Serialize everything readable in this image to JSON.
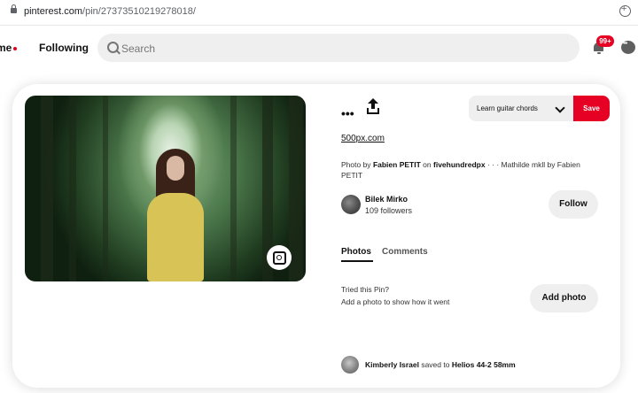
{
  "browser": {
    "url_host": "pinterest.com",
    "url_path": "/pin/273735102192780​18/"
  },
  "nav": {
    "home_label": "me",
    "following_label": "Following",
    "search_placeholder": "Search",
    "notification_count": "99+"
  },
  "pin": {
    "board_name": "Learn guitar chords",
    "save_label": "Save",
    "source_link": "500px.com",
    "credit": {
      "prefix": "Photo by",
      "author": "Fabien PETIT",
      "on": "on",
      "site": "fivehundredpx",
      "suffix": "· · · Mathilde mkll by Fabien PETIT"
    },
    "creator": {
      "name": "Bilek Mirko",
      "followers": "109 followers",
      "follow_label": "Follow"
    },
    "tabs": [
      "Photos",
      "Comments"
    ],
    "tried": {
      "title": "Tried this Pin?",
      "subtitle": "Add a photo to show how it went",
      "button": "Add photo"
    },
    "saved_by": {
      "user": "Kimberly Israel",
      "saved_to": "saved to",
      "board": "Helios 44-2 58mm"
    }
  },
  "colors": {
    "brand_red": "#e60023",
    "pill_gray": "#efefef"
  },
  "icons": [
    "lock-icon",
    "extension-icon",
    "search-icon",
    "bell-icon",
    "chat-icon",
    "more-icon",
    "share-icon",
    "chevron-down-icon",
    "visual-search-icon"
  ]
}
